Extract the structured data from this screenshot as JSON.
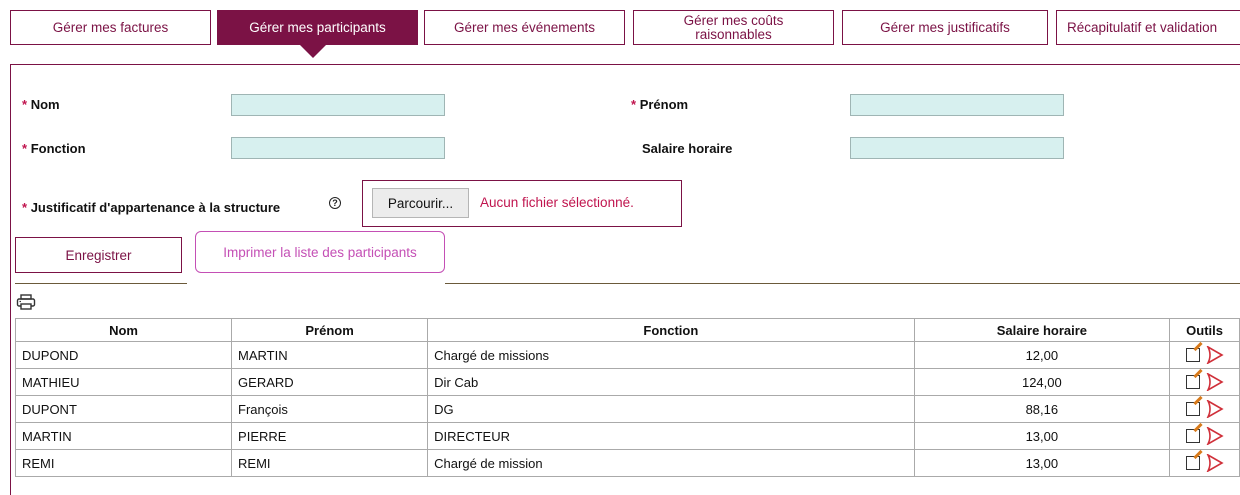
{
  "tabs": [
    {
      "label": "Gérer mes factures",
      "active": false
    },
    {
      "label": "Gérer mes participants",
      "active": true
    },
    {
      "label": "Gérer mes événements",
      "active": false
    },
    {
      "label": "Gérer mes coûts\nraisonnables",
      "active": false
    },
    {
      "label": "Gérer mes justificatifs",
      "active": false
    },
    {
      "label": "Récapitulatif et validation",
      "active": false
    }
  ],
  "form": {
    "required_mark": "*",
    "nom_label": "Nom",
    "prenom_label": "Prénom",
    "fonction_label": "Fonction",
    "salaire_label": "Salaire horaire",
    "justificatif_label": "Justificatif d'appartenance à la structure",
    "help_icon": "?",
    "browse_label": "Parcourir...",
    "no_file_text": "Aucun fichier sélectionné.",
    "nom_value": "",
    "prenom_value": "",
    "fonction_value": "",
    "salaire_value": ""
  },
  "actions": {
    "save_label": "Enregistrer",
    "print_list_label": "Imprimer la liste des participants"
  },
  "table": {
    "headers": {
      "nom": "Nom",
      "prenom": "Prénom",
      "fonction": "Fonction",
      "salaire": "Salaire horaire",
      "outils": "Outils"
    },
    "rows": [
      {
        "nom": "DUPOND",
        "prenom": "MARTIN",
        "fonction": "Chargé de missions",
        "salaire": "12,00"
      },
      {
        "nom": "MATHIEU",
        "prenom": "GERARD",
        "fonction": "Dir Cab",
        "salaire": "124,00"
      },
      {
        "nom": "DUPONT",
        "prenom": "François",
        "fonction": "DG",
        "salaire": "88,16"
      },
      {
        "nom": "MARTIN",
        "prenom": "PIERRE",
        "fonction": "DIRECTEUR",
        "salaire": "13,00"
      },
      {
        "nom": "REMI",
        "prenom": "REMI",
        "fonction": "Chargé de mission",
        "salaire": "13,00"
      }
    ]
  },
  "icons": {
    "print": "printer-icon",
    "edit": "edit-icon",
    "pdf": "pdf-icon"
  },
  "colors": {
    "brand": "#7b1245",
    "input_bg": "#d7f0ef",
    "print_button": "#c44fb5",
    "required": "#c0144e"
  }
}
